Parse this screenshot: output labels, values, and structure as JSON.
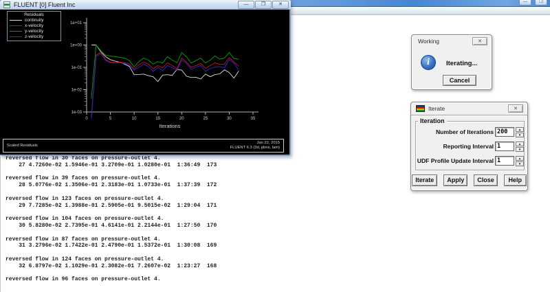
{
  "icons": {
    "close": "✕",
    "minimize": "—",
    "maximize": "❐",
    "spinner_up": "▲",
    "spinner_down": "▼",
    "info": "i"
  },
  "desktop_window": {
    "minimize": "—",
    "maximize": "❐"
  },
  "fluent_window": {
    "title": "FLUENT [0] Fluent Inc",
    "caption_left": "Scaled Residuals",
    "caption_date": "Jan 22, 2015",
    "caption_version": "FLUENT 6.3 (3d, pbns, lam)"
  },
  "chart_data": {
    "type": "line",
    "title": "Residuals",
    "xlabel": "Iterations",
    "ylog": true,
    "ylim": [
      0.001,
      10
    ],
    "xlim": [
      0,
      35
    ],
    "x_ticks": [
      0,
      5,
      10,
      15,
      20,
      25,
      30,
      35
    ],
    "y_tick_labels": [
      "1e+01",
      "1e+00",
      "1e-01",
      "1e-02",
      "1e-03"
    ],
    "grid": false,
    "legend_position": "top-left",
    "x": [
      1,
      2,
      3,
      4,
      5,
      6,
      7,
      8,
      9,
      10,
      11,
      12,
      13,
      14,
      15,
      16,
      17,
      18,
      19,
      20,
      21,
      22,
      23,
      24,
      25,
      26,
      27,
      28,
      29,
      30,
      31,
      32
    ],
    "series": [
      {
        "name": "continuity",
        "color": "#dcdcdc",
        "values": [
          1.0,
          1.0,
          0.5,
          0.3,
          0.22,
          0.19,
          0.17,
          0.14,
          0.11,
          0.047,
          0.048,
          0.05,
          0.042,
          0.038,
          0.023,
          0.045,
          0.047,
          0.044,
          0.08,
          0.075,
          0.04,
          0.035,
          0.036,
          0.03,
          0.05,
          0.038,
          0.04726,
          0.050776,
          0.077285,
          0.05828,
          0.032796,
          0.068797
        ]
      },
      {
        "name": "x-velocity",
        "color": "#cc1111",
        "values": [
          0.0006,
          0.35,
          0.48,
          0.22,
          0.17,
          0.165,
          0.17,
          0.165,
          0.14,
          0.085,
          0.13,
          0.17,
          0.14,
          0.085,
          0.12,
          0.095,
          0.16,
          0.12,
          0.085,
          0.26,
          0.17,
          0.1,
          0.12,
          0.15,
          0.09,
          0.12,
          0.15946,
          0.13506,
          0.13988,
          0.27395,
          0.17422,
          0.11029
        ]
      },
      {
        "name": "y-velocity",
        "color": "#00a300",
        "values": [
          0.004,
          1.0,
          0.55,
          0.35,
          0.32,
          0.3,
          0.28,
          0.26,
          0.2,
          0.105,
          0.18,
          0.26,
          0.21,
          0.14,
          0.18,
          0.155,
          0.3,
          0.21,
          0.16,
          0.46,
          0.3,
          0.155,
          0.2,
          0.26,
          0.155,
          0.21,
          0.32709,
          0.23183,
          0.25905,
          0.46141,
          0.2479,
          0.23082
        ]
      },
      {
        "name": "z-velocity",
        "color": "#2a2ae0",
        "values": [
          0.0005,
          0.3,
          0.42,
          0.2,
          0.16,
          0.155,
          0.16,
          0.15,
          0.12,
          0.075,
          0.1,
          0.14,
          0.11,
          0.065,
          0.1,
          0.07,
          0.12,
          0.095,
          0.075,
          0.21,
          0.15,
          0.08,
          0.1,
          0.12,
          0.065,
          0.09,
          0.1028,
          0.10733,
          0.095015,
          0.22144,
          0.15372,
          0.072607
        ]
      }
    ]
  },
  "console": {
    "lines": [
      "reversed flow in 30 faces on pressure-outlet 4.",
      "    27 4.7260e-02 1.5946e-01 3.2709e-01 1.0280e-01  1:36:49  173",
      "",
      "reversed flow in 39 faces on pressure-outlet 4.",
      "    28 5.0776e-02 1.3506e-01 2.3183e-01 1.0733e-01  1:37:39  172",
      "",
      "reversed flow in 123 faces on pressure-outlet 4.",
      "    29 7.7285e-02 1.3988e-01 2.5905e-01 9.5015e-02  1:29:04  171",
      "",
      "reversed flow in 104 faces on pressure-outlet 4.",
      "    30 5.8280e-02 2.7395e-01 4.6141e-01 2.2144e-01  1:27:50  170",
      "",
      "reversed flow in 87 faces on pressure-outlet 4.",
      "    31 3.2796e-02 1.7422e-01 2.4790e-01 1.5372e-01  1:30:08  169",
      "",
      "reversed flow in 124 faces on pressure-outlet 4.",
      "    32 6.8797e-02 1.1029e-01 2.3082e-01 7.2607e-02  1:23:27  168",
      "",
      "reversed flow in 96 faces on pressure-outlet 4."
    ]
  },
  "working_dialog": {
    "title": "Working",
    "message": "Iterating...",
    "cancel_label": "Cancel"
  },
  "iterate_dialog": {
    "title": "Iterate",
    "group_label": "Iteration",
    "fields": [
      {
        "label": "Number of Iterations",
        "value": "200"
      },
      {
        "label": "Reporting Interval",
        "value": "1"
      },
      {
        "label": "UDF Profile Update Interval",
        "value": "1"
      }
    ],
    "buttons": [
      "Iterate",
      "Apply",
      "Close",
      "Help"
    ]
  }
}
